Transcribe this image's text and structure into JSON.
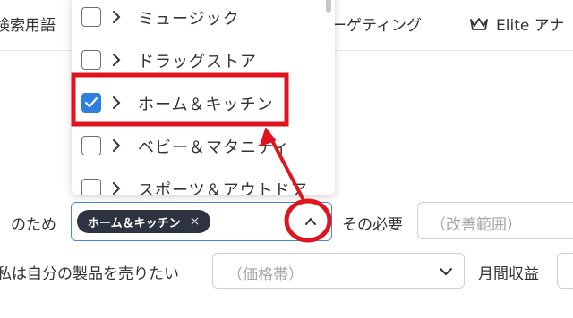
{
  "nav": {
    "left_text": "検索用語",
    "mid_text": "ーゲティング",
    "right_text": "Elite アナ"
  },
  "dropdown": {
    "items": [
      {
        "label": "ミュージック",
        "checked": false
      },
      {
        "label": "ドラッグストア",
        "checked": false
      },
      {
        "label": "ホーム＆キッチン",
        "checked": true
      },
      {
        "label": "ベビー＆マタニティ",
        "checked": false
      },
      {
        "label": "スポーツ＆アウトドア",
        "checked": false
      }
    ]
  },
  "form": {
    "for_label": "のため",
    "selected_chip": "ホーム＆キッチン",
    "chip_remove": "×",
    "need_label": "その必要",
    "need_placeholder": "（改善範囲）",
    "sell_label": "私は自分の製品を売りたい",
    "price_placeholder": "（価格帯）",
    "monthly_label": "月間収益"
  },
  "colors": {
    "accent": "#2f7fe0",
    "annotation": "#e0141e",
    "chip_bg": "#2d3340"
  }
}
